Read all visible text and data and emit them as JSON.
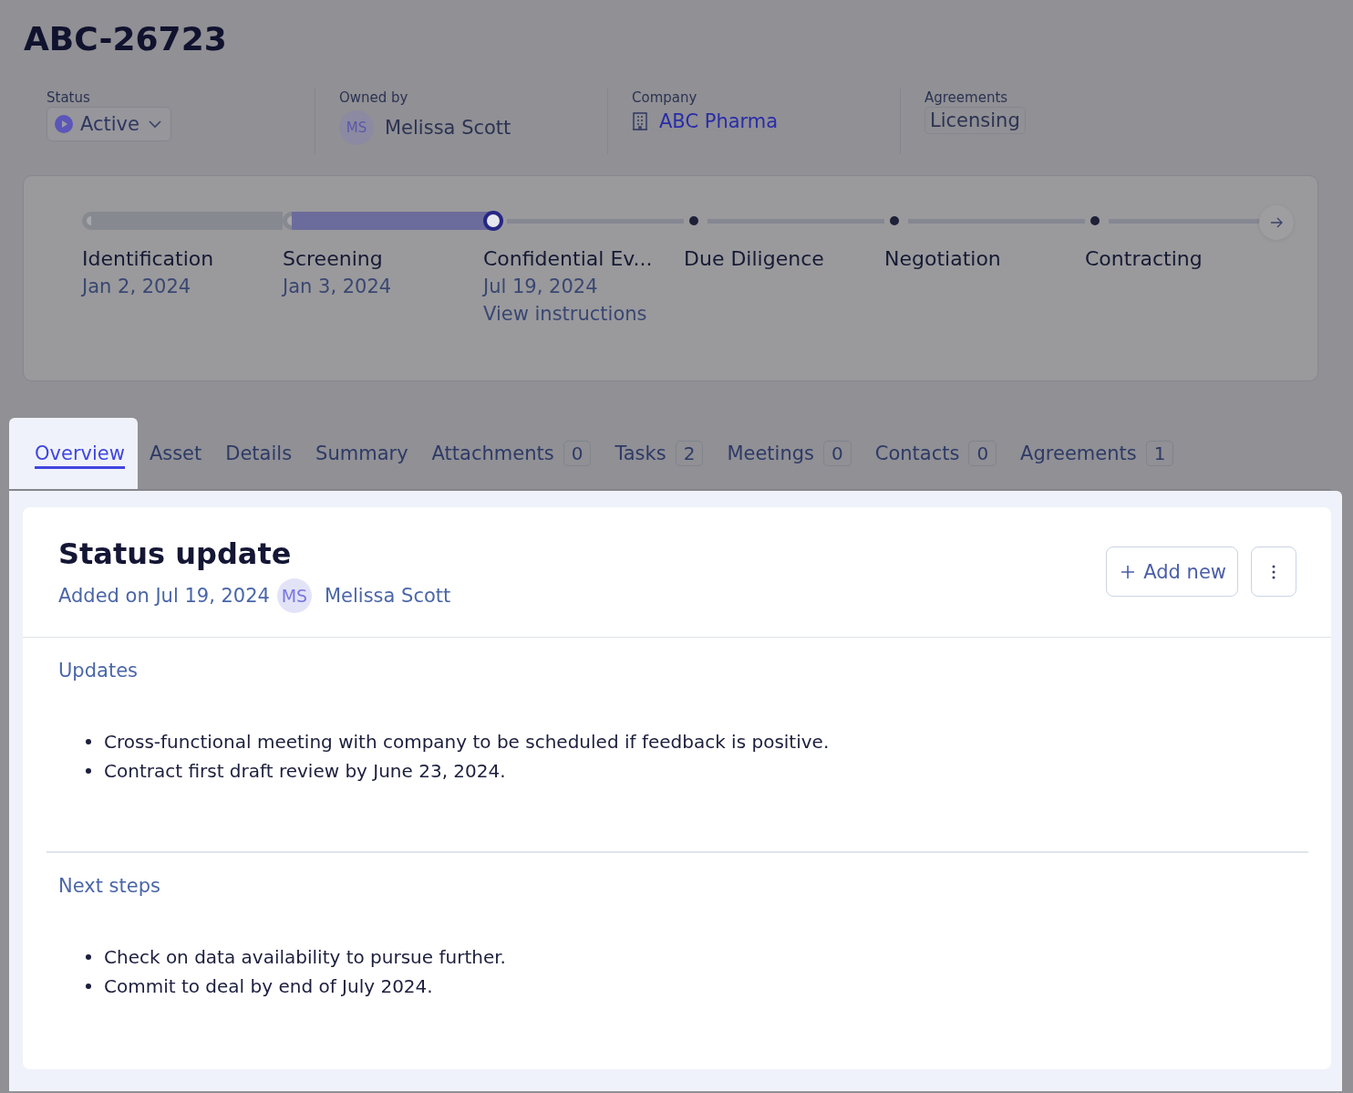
{
  "title": "ABC-26723",
  "fields": [
    {
      "kind": "status",
      "label": "Status",
      "value": "Active"
    },
    {
      "kind": "owner",
      "label": "Owned by",
      "initials": "MS",
      "value": "Melissa Scott"
    },
    {
      "kind": "company",
      "label": "Company",
      "value": "ABC Pharma"
    },
    {
      "kind": "tag",
      "label": "Agreements",
      "value": "Licensing"
    }
  ],
  "stages": [
    {
      "label": "Identification",
      "date": "Jan 2, 2024",
      "done": true,
      "current": false
    },
    {
      "label": "Screening",
      "date": "Jan 3, 2024",
      "done": true,
      "current": false
    },
    {
      "label": "Confidential Ev...",
      "date": "Jul 19, 2024",
      "link": "View instructions",
      "done": false,
      "current": true
    },
    {
      "label": "Due Diligence",
      "done": false,
      "current": false
    },
    {
      "label": "Negotiation",
      "done": false,
      "current": false
    },
    {
      "label": "Contracting",
      "done": false,
      "current": false
    }
  ],
  "tabs": [
    {
      "label": "Overview",
      "selected": true
    },
    {
      "label": "Asset",
      "selected": false
    },
    {
      "label": "Details",
      "selected": false
    },
    {
      "label": "Summary",
      "selected": false
    },
    {
      "label": "Attachments",
      "count": "0",
      "selected": false
    },
    {
      "label": "Tasks",
      "count": "2",
      "selected": false
    },
    {
      "label": "Meetings",
      "count": "0",
      "selected": false
    },
    {
      "label": "Contacts",
      "count": "0",
      "selected": false
    },
    {
      "label": "Agreements",
      "count": "1",
      "selected": false
    }
  ],
  "status_update": {
    "title": "Status update",
    "added": "Added on Jul 19, 2024",
    "initials": "MS",
    "author": "Melissa Scott",
    "add_button": "Add new",
    "sections": [
      {
        "heading": "Updates",
        "items": [
          "Cross-functional meeting with company to be scheduled if feedback is positive.",
          "Contract first draft review by June 23, 2024."
        ]
      },
      {
        "heading": "Next steps",
        "items": [
          "Check on data availability to pursue further.",
          "Commit to deal by end of July 2024."
        ]
      }
    ]
  }
}
